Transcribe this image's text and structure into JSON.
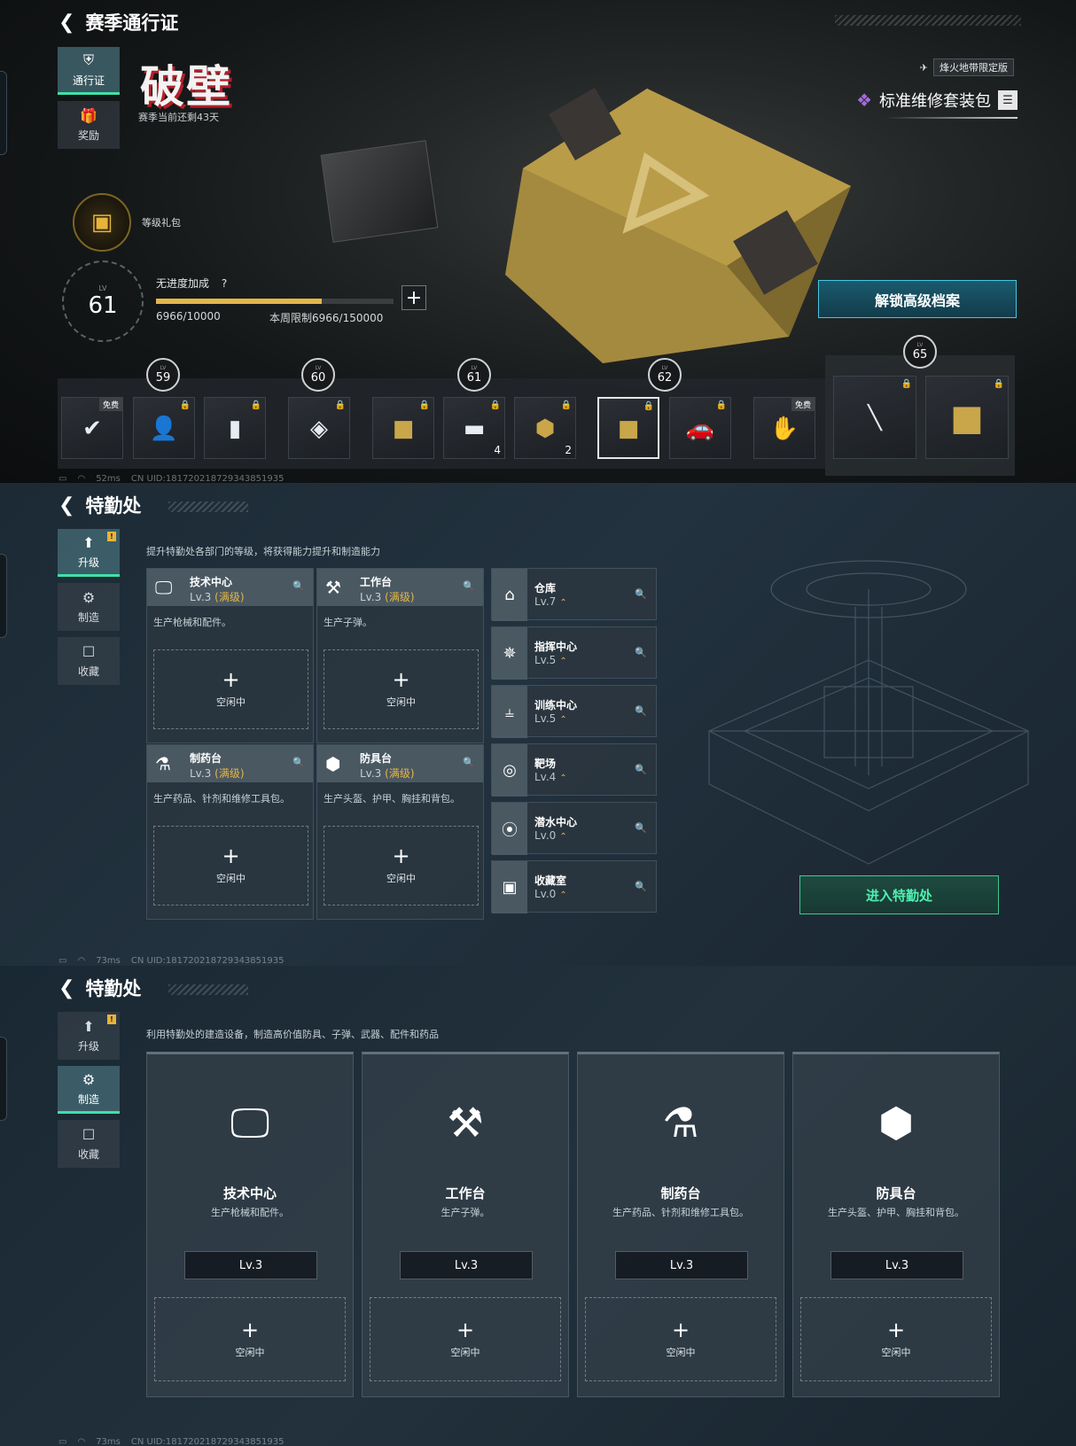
{
  "s1": {
    "title": "赛季通行证",
    "nav": [
      {
        "label": "通行证",
        "icon": "pass-icon"
      },
      {
        "label": "奖励",
        "icon": "gift-icon"
      }
    ],
    "season_logo": "破壁",
    "season_remaining": "赛季当前还剩43天",
    "edition_label": "烽火地带限定版",
    "package_name": "标准维修套装包",
    "level_gift_label": "等级礼包",
    "level_label": "LV",
    "level": "61",
    "progress_title": "无进度加成",
    "progress_help": "?",
    "progress_fraction": 0.6966,
    "progress_text": "6966/10000",
    "weekly_limit": "本周限制6966/150000",
    "unlock_button": "解锁高级档案",
    "free_tag": "免费",
    "levels": [
      "59",
      "60",
      "61",
      "62",
      "65"
    ],
    "counts": [
      "4",
      "2"
    ],
    "status": {
      "ping": "52ms",
      "uid": "CN UID:18172021872934385193​5"
    }
  },
  "s2": {
    "title": "特勤处",
    "nav": [
      {
        "label": "升级"
      },
      {
        "label": "制造"
      },
      {
        "label": "收藏"
      }
    ],
    "badge": "!",
    "description": "提升特勤处各部门的等级，将获得能力提升和制造能力",
    "cards": [
      {
        "name": "技术中心",
        "level": "Lv.3",
        "max": "(满级)",
        "desc": "生产枪械和配件。",
        "slot": "空闲中"
      },
      {
        "name": "工作台",
        "level": "Lv.3",
        "max": "(满级)",
        "desc": "生产子弹。",
        "slot": "空闲中"
      },
      {
        "name": "制药台",
        "level": "Lv.3",
        "max": "(满级)",
        "desc": "生产药品、针剂和维修工具包。",
        "slot": "空闲中"
      },
      {
        "name": "防具台",
        "level": "Lv.3",
        "max": "(满级)",
        "desc": "生产头盔、护甲、胸挂和背包。",
        "slot": "空闲中"
      }
    ],
    "rows": [
      {
        "name": "仓库",
        "level": "Lv.7"
      },
      {
        "name": "指挥中心",
        "level": "Lv.5"
      },
      {
        "name": "训练中心",
        "level": "Lv.5"
      },
      {
        "name": "靶场",
        "level": "Lv.4"
      },
      {
        "name": "潜水中心",
        "level": "Lv.0"
      },
      {
        "name": "收藏室",
        "level": "Lv.0"
      }
    ],
    "enter_button": "进入特勤处",
    "status": {
      "ping": "73ms",
      "uid": "CN UID:18172021872934385193​5"
    }
  },
  "s3": {
    "title": "特勤处",
    "nav": [
      {
        "label": "升级"
      },
      {
        "label": "制造"
      },
      {
        "label": "收藏"
      }
    ],
    "badge": "!",
    "description": "利用特勤处的建造设备，制造高价值防具、子弹、武器、配件和药品",
    "cards": [
      {
        "name": "技术中心",
        "desc": "生产枪械和配件。",
        "level": "Lv.3",
        "slot": "空闲中"
      },
      {
        "name": "工作台",
        "desc": "生产子弹。",
        "level": "Lv.3",
        "slot": "空闲中"
      },
      {
        "name": "制药台",
        "desc": "生产药品、针剂和维修工具包。",
        "level": "Lv.3",
        "slot": "空闲中"
      },
      {
        "name": "防具台",
        "desc": "生产头盔、护甲、胸挂和背包。",
        "level": "Lv.3",
        "slot": "空闲中"
      }
    ],
    "status": {
      "ping": "73ms",
      "uid": "CN UID:18172021872934385193​5"
    }
  },
  "colors": {
    "accent_gold": "#e3b64a",
    "accent_green": "#3fe0a8",
    "accent_cyan": "#44c7e4"
  }
}
